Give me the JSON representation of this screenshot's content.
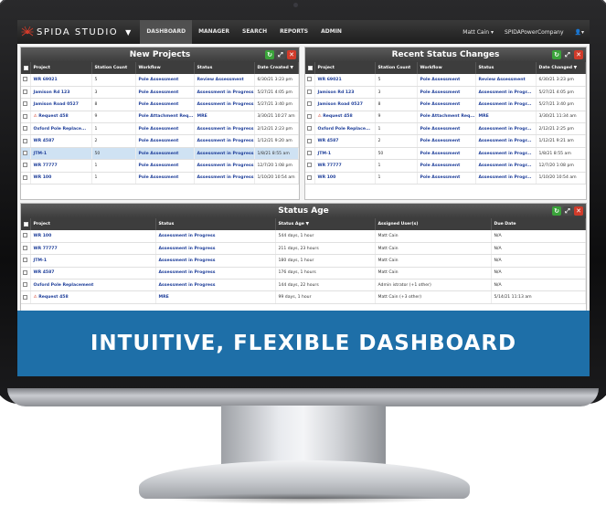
{
  "app": {
    "logo_text": "SPIDA STUDIO"
  },
  "nav": {
    "items": [
      "DASHBOARD",
      "MANAGER",
      "SEARCH",
      "REPORTS",
      "ADMIN"
    ],
    "user": "Matt Cain",
    "company": "SPIDAPowerCompany"
  },
  "new_projects": {
    "title": "New Projects",
    "columns": [
      "Project",
      "Station Count",
      "Workflow",
      "Status",
      "Date Created"
    ],
    "rows": [
      [
        "WR 69021",
        "5",
        "Pole Assessment",
        "Review Assessment",
        "6/30/21 3:23 pm"
      ],
      [
        "Jamison Rd 123",
        "3",
        "Pole Assessment",
        "Assessment in Progress",
        "5/27/21 4:05 pm"
      ],
      [
        "Jamison Road 0527",
        "8",
        "Pole Assessment",
        "Assessment in Progress",
        "5/27/21 3:40 pm"
      ],
      [
        "Request 458",
        "9",
        "Pole Attachment Req...",
        "MRE",
        "3/30/21 10:27 am"
      ],
      [
        "Oxford Pole Replace...",
        "1",
        "Pole Assessment",
        "Assessment in Progress",
        "2/12/21 2:23 pm"
      ],
      [
        "WR 4587",
        "2",
        "Pole Assessment",
        "Assessment in Progress",
        "1/12/21 9:20 am"
      ],
      [
        "JTM-1",
        "50",
        "Pole Assessment",
        "Assessment in Progress",
        "1/8/21 8:55 am"
      ],
      [
        "WR 77777",
        "1",
        "Pole Assessment",
        "Assessment in Progress",
        "12/7/20 1:08 pm"
      ],
      [
        "WR 100",
        "1",
        "Pole Assessment",
        "Assessment in Progress",
        "1/10/20 10:54 am"
      ]
    ]
  },
  "recent_status": {
    "title": "Recent Status Changes",
    "columns": [
      "Project",
      "Station Count",
      "Workflow",
      "Status",
      "Date Changed"
    ],
    "rows": [
      [
        "WR 69021",
        "5",
        "Pole Assessment",
        "Review Assessment",
        "6/30/21 3:23 pm"
      ],
      [
        "Jamison Rd 123",
        "3",
        "Pole Assessment",
        "Assessment in Progr...",
        "5/27/21 4:05 pm"
      ],
      [
        "Jamison Road 0527",
        "8",
        "Pole Assessment",
        "Assessment in Progr...",
        "5/27/21 3:40 pm"
      ],
      [
        "Request 458",
        "9",
        "Pole Attachment Req...",
        "MRE",
        "3/30/21 11:34 am"
      ],
      [
        "Oxford Pole Replace...",
        "1",
        "Pole Assessment",
        "Assessment in Progr...",
        "2/12/21 2:25 pm"
      ],
      [
        "WR 4587",
        "2",
        "Pole Assessment",
        "Assessment in Progr...",
        "1/12/21 9:21 am"
      ],
      [
        "JTM-1",
        "50",
        "Pole Assessment",
        "Assessment in Progr...",
        "1/8/21 8:55 am"
      ],
      [
        "WR 77777",
        "1",
        "Pole Assessment",
        "Assessment in Progr...",
        "12/7/20 1:08 pm"
      ],
      [
        "WR 100",
        "1",
        "Pole Assessment",
        "Assessment in Progr...",
        "1/10/20 10:54 am"
      ]
    ]
  },
  "status_age": {
    "title": "Status Age",
    "columns": [
      "Project",
      "Status",
      "Status Age",
      "Assigned User(s)",
      "Due Date"
    ],
    "rows": [
      [
        "WR 100",
        "Assessment in Progress",
        "544 days, 1 hour",
        "Matt Cain",
        "N/A"
      ],
      [
        "WR 77777",
        "Assessment in Progress",
        "211 days, 23 hours",
        "Matt Cain",
        "N/A"
      ],
      [
        "JTM-1",
        "Assessment in Progress",
        "180 days, 1 hour",
        "Matt Cain",
        "N/A"
      ],
      [
        "WR 4587",
        "Assessment in Progress",
        "176 days, 1 hours",
        "Matt Cain",
        "N/A"
      ],
      [
        "Oxford Pole Replacement",
        "Assessment in Progress",
        "144 days, 22 hours",
        "Admin istrator (+1 other)",
        "N/A"
      ],
      [
        "Request 458",
        "MRE",
        "99 days, 1 hour",
        "Matt Cain (+3 other)",
        "5/14/21 11:13 am"
      ]
    ]
  },
  "banner": {
    "text": "INTUITIVE, FLEXIBLE DASHBOARD"
  },
  "colors": {
    "accent": "#1e6fa8",
    "link": "#1f3f9a",
    "highlight": "#cfe2f3"
  }
}
